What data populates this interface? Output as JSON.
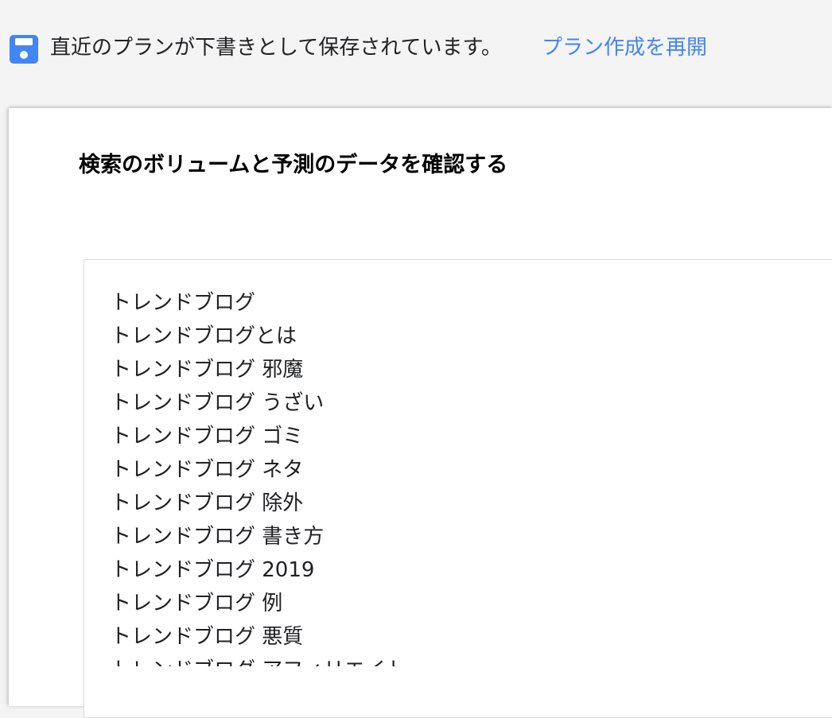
{
  "banner": {
    "icon": "save-icon",
    "message": "直近のプランが下書きとして保存されています。",
    "link_label": "プラン作成を再開",
    "icon_color": "#4285f4",
    "link_color": "#4285f4"
  },
  "card": {
    "title": "検索のボリュームと予測のデータを確認する"
  },
  "keywords": [
    "トレンドブログ",
    "トレンドブログとは",
    "トレンドブログ 邪魔",
    "トレンドブログ うざい",
    "トレンドブログ ゴミ",
    "トレンドブログ ネタ",
    "トレンドブログ 除外",
    "トレンドブログ 書き方",
    "トレンドブログ 2019",
    "トレンドブログ 例",
    "トレンドブログ 悪質",
    "トレンドブログ アフィリエイト"
  ]
}
